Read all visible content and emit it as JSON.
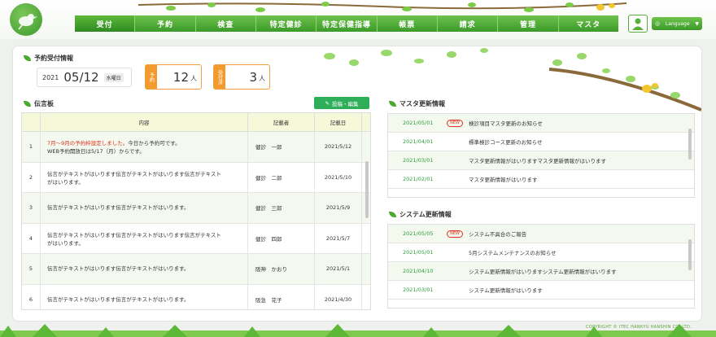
{
  "nav": {
    "items": [
      "受付",
      "予約",
      "検査",
      "特定健診",
      "特定保健指導",
      "帳票",
      "請求",
      "管理",
      "マスタ"
    ],
    "active_index": 0
  },
  "language": {
    "label": "Language"
  },
  "reception": {
    "title": "予約受付情報",
    "year": "2021",
    "month_day": "05/12",
    "weekday": "水曜日",
    "reserved": {
      "tag": "予約",
      "count": "12",
      "unit": "人"
    },
    "accepted": {
      "tag": "受付済",
      "count": "3",
      "unit": "人"
    }
  },
  "bulletin": {
    "title": "伝言板",
    "post_button": "投稿・編集",
    "headers": {
      "content": "内容",
      "author": "記載者",
      "date": "記載日"
    },
    "rows": [
      {
        "no": "1",
        "highlight": "7月～9月の予約枠設定しました。",
        "content": "今日から予約可です。",
        "content2": "WEB予約開放日は5/17（月）からです。",
        "author": "健診　一郎",
        "date": "2021/5/12"
      },
      {
        "no": "2",
        "highlight": "",
        "content": "伝言がテキストがはいります伝言がテキストがはいります伝言がテキスト",
        "content2": "がはいります。",
        "author": "健診　二郎",
        "date": "2021/5/10"
      },
      {
        "no": "3",
        "highlight": "",
        "content": "伝言がテキストがはいります伝言がテキストがはいります。",
        "content2": "",
        "author": "健診　三郎",
        "date": "2021/5/9"
      },
      {
        "no": "4",
        "highlight": "",
        "content": "伝言がテキストがはいります伝言がテキストがはいります伝言がテキスト",
        "content2": "がはいります。",
        "author": "健診　四郎",
        "date": "2021/5/7"
      },
      {
        "no": "5",
        "highlight": "",
        "content": "伝言がテキストがはいります伝言がテキストがはいります。",
        "content2": "",
        "author": "阪神　かおり",
        "date": "2021/5/1"
      },
      {
        "no": "6",
        "highlight": "",
        "content": "伝言がテキストがはいります伝言がテキストがはいります。",
        "content2": "",
        "author": "阪急　花子",
        "date": "2021/4/30"
      }
    ]
  },
  "master": {
    "title": "マスタ更新情報",
    "new_label": "NEW",
    "rows": [
      {
        "date": "2021/05/01",
        "new": true,
        "text": "検診項目マスタ更新のお知らせ"
      },
      {
        "date": "2021/04/01",
        "new": false,
        "text": "標準検診コース更新のお知らせ"
      },
      {
        "date": "2021/03/01",
        "new": false,
        "text": "マスタ更新情報がはいりますマスタ更新情報がはいります"
      },
      {
        "date": "2021/02/01",
        "new": false,
        "text": "マスタ更新情報がはいります"
      }
    ]
  },
  "system": {
    "title": "システム更新情報",
    "new_label": "NEW",
    "rows": [
      {
        "date": "2021/05/05",
        "new": true,
        "text": "システム不具合のご報告"
      },
      {
        "date": "2021/05/01",
        "new": false,
        "text": "5月システムメンテナンスのお知らせ"
      },
      {
        "date": "2021/04/10",
        "new": false,
        "text": "システム更新情報がはいりますシステム更新情報がはいります"
      },
      {
        "date": "2021/03/01",
        "new": false,
        "text": "システム更新情報がはいります"
      }
    ]
  },
  "footer": {
    "copyright": "COPYRIGHT © ITEC HANKYU HANSHIN CO.,LTD."
  },
  "colors": {
    "brand_green": "#4aaa2e",
    "accent_orange": "#f29a2e",
    "new_red": "#e0301e"
  }
}
